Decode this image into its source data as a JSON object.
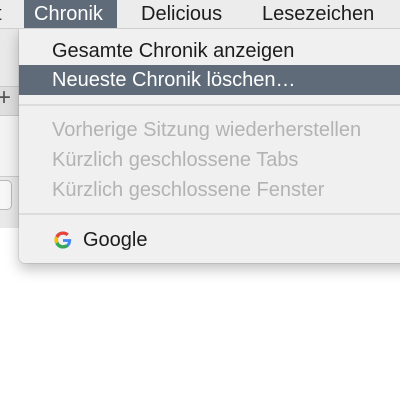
{
  "menubar": {
    "edge_fragment": "t",
    "items": [
      {
        "label": "Chronik",
        "active": true
      },
      {
        "label": "Delicious",
        "active": false
      },
      {
        "label": "Lesezeichen",
        "active": false
      }
    ]
  },
  "dropdown": {
    "items": [
      {
        "label": "Gesamte Chronik anzeigen",
        "state": "normal"
      },
      {
        "label": "Neueste Chronik löschen…",
        "state": "highlighted"
      },
      {
        "label": "Vorherige Sitzung wiederherstellen",
        "state": "disabled"
      },
      {
        "label": "Kürzlich geschlossene Tabs",
        "state": "disabled"
      },
      {
        "label": "Kürzlich geschlossene Fenster",
        "state": "disabled"
      },
      {
        "label": "Google",
        "state": "normal",
        "icon": "google-icon"
      }
    ]
  },
  "background": {
    "new_tab_symbol": "+"
  },
  "colors": {
    "menubar_bg": "#ececec",
    "highlight": "#5f6b78",
    "menu_bg": "#f0f0f0",
    "disabled_text": "#b3b3b3",
    "google_blue": "#4285F4",
    "google_red": "#EA4335",
    "google_yellow": "#FBBC05",
    "google_green": "#34A853"
  }
}
